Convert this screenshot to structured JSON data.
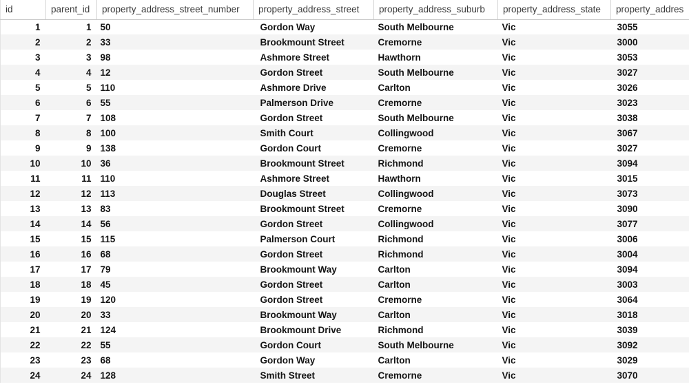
{
  "table": {
    "columns": [
      {
        "key": "id",
        "label": "id",
        "align": "right"
      },
      {
        "key": "parent_id",
        "label": "parent_id",
        "align": "right"
      },
      {
        "key": "number",
        "label": "property_address_street_number",
        "align": "left"
      },
      {
        "key": "street",
        "label": "property_address_street",
        "align": "left"
      },
      {
        "key": "suburb",
        "label": "property_address_suburb",
        "align": "left"
      },
      {
        "key": "state",
        "label": "property_address_state",
        "align": "left"
      },
      {
        "key": "postcode",
        "label": "property_addres",
        "align": "left"
      }
    ],
    "row_count": 24,
    "rows": [
      {
        "id": "1",
        "parent_id": "1",
        "number": "50",
        "street": "Gordon Way",
        "suburb": "South Melbourne",
        "state": "Vic",
        "postcode": "3055"
      },
      {
        "id": "2",
        "parent_id": "2",
        "number": "33",
        "street": "Brookmount Street",
        "suburb": "Cremorne",
        "state": "Vic",
        "postcode": "3000"
      },
      {
        "id": "3",
        "parent_id": "3",
        "number": "98",
        "street": "Ashmore Street",
        "suburb": "Hawthorn",
        "state": "Vic",
        "postcode": "3053"
      },
      {
        "id": "4",
        "parent_id": "4",
        "number": "12",
        "street": "Gordon Street",
        "suburb": "South Melbourne",
        "state": "Vic",
        "postcode": "3027"
      },
      {
        "id": "5",
        "parent_id": "5",
        "number": "110",
        "street": "Ashmore Drive",
        "suburb": "Carlton",
        "state": "Vic",
        "postcode": "3026"
      },
      {
        "id": "6",
        "parent_id": "6",
        "number": "55",
        "street": "Palmerson Drive",
        "suburb": "Cremorne",
        "state": "Vic",
        "postcode": "3023"
      },
      {
        "id": "7",
        "parent_id": "7",
        "number": "108",
        "street": "Gordon Street",
        "suburb": "South Melbourne",
        "state": "Vic",
        "postcode": "3038"
      },
      {
        "id": "8",
        "parent_id": "8",
        "number": "100",
        "street": "Smith Court",
        "suburb": "Collingwood",
        "state": "Vic",
        "postcode": "3067"
      },
      {
        "id": "9",
        "parent_id": "9",
        "number": "138",
        "street": "Gordon Court",
        "suburb": "Cremorne",
        "state": "Vic",
        "postcode": "3027"
      },
      {
        "id": "10",
        "parent_id": "10",
        "number": "36",
        "street": "Brookmount Street",
        "suburb": "Richmond",
        "state": "Vic",
        "postcode": "3094"
      },
      {
        "id": "11",
        "parent_id": "11",
        "number": "110",
        "street": "Ashmore Street",
        "suburb": "Hawthorn",
        "state": "Vic",
        "postcode": "3015"
      },
      {
        "id": "12",
        "parent_id": "12",
        "number": "113",
        "street": "Douglas Street",
        "suburb": "Collingwood",
        "state": "Vic",
        "postcode": "3073"
      },
      {
        "id": "13",
        "parent_id": "13",
        "number": "83",
        "street": "Brookmount Street",
        "suburb": "Cremorne",
        "state": "Vic",
        "postcode": "3090"
      },
      {
        "id": "14",
        "parent_id": "14",
        "number": "56",
        "street": "Gordon Street",
        "suburb": "Collingwood",
        "state": "Vic",
        "postcode": "3077"
      },
      {
        "id": "15",
        "parent_id": "15",
        "number": "115",
        "street": "Palmerson Court",
        "suburb": "Richmond",
        "state": "Vic",
        "postcode": "3006"
      },
      {
        "id": "16",
        "parent_id": "16",
        "number": "68",
        "street": "Gordon Street",
        "suburb": "Richmond",
        "state": "Vic",
        "postcode": "3004"
      },
      {
        "id": "17",
        "parent_id": "17",
        "number": "79",
        "street": "Brookmount Way",
        "suburb": "Carlton",
        "state": "Vic",
        "postcode": "3094"
      },
      {
        "id": "18",
        "parent_id": "18",
        "number": "45",
        "street": "Gordon Street",
        "suburb": "Carlton",
        "state": "Vic",
        "postcode": "3003"
      },
      {
        "id": "19",
        "parent_id": "19",
        "number": "120",
        "street": "Gordon Street",
        "suburb": "Cremorne",
        "state": "Vic",
        "postcode": "3064"
      },
      {
        "id": "20",
        "parent_id": "20",
        "number": "33",
        "street": "Brookmount Way",
        "suburb": "Carlton",
        "state": "Vic",
        "postcode": "3018"
      },
      {
        "id": "21",
        "parent_id": "21",
        "number": "124",
        "street": "Brookmount Drive",
        "suburb": "Richmond",
        "state": "Vic",
        "postcode": "3039"
      },
      {
        "id": "22",
        "parent_id": "22",
        "number": "55",
        "street": "Gordon Court",
        "suburb": "South Melbourne",
        "state": "Vic",
        "postcode": "3092"
      },
      {
        "id": "23",
        "parent_id": "23",
        "number": "68",
        "street": "Gordon Way",
        "suburb": "Carlton",
        "state": "Vic",
        "postcode": "3029"
      },
      {
        "id": "24",
        "parent_id": "24",
        "number": "128",
        "street": "Smith Street",
        "suburb": "Cremorne",
        "state": "Vic",
        "postcode": "3070"
      }
    ]
  },
  "colors": {
    "row_stripe": "#f4f4f4",
    "row_base": "#ffffff",
    "header_rule": "#c9c9c9",
    "column_divider": "#d4d4d4",
    "text": "#141414",
    "header_text": "#3a3a3a"
  }
}
